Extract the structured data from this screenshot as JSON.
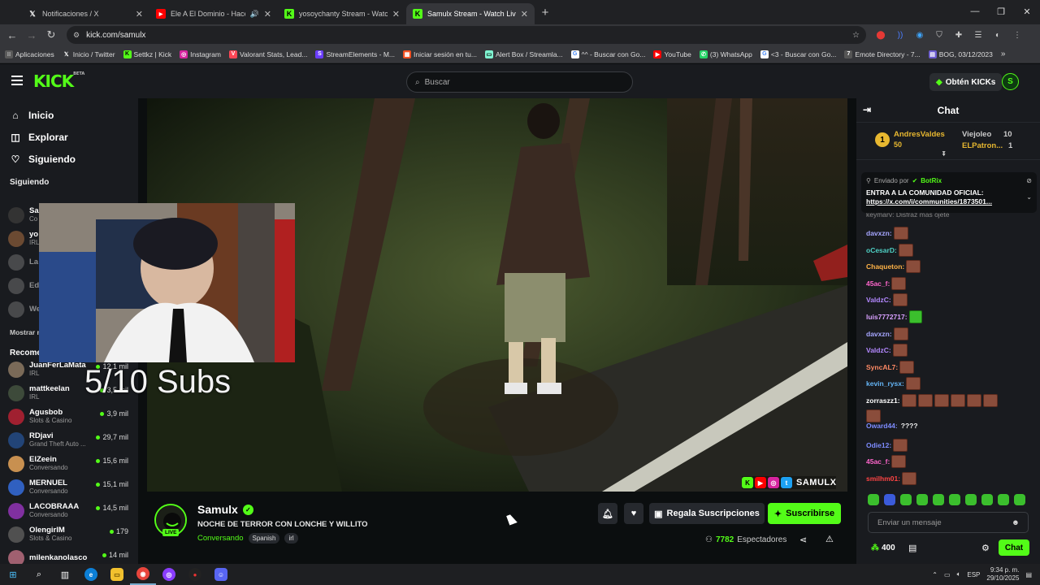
{
  "browser": {
    "tabs": [
      {
        "title": "Notificaciones / X",
        "icon": "x-icon"
      },
      {
        "title": "Ele A El Dominio - Hace Mu",
        "icon": "youtube-icon"
      },
      {
        "title": "yosoychanty Stream - Watch Li",
        "icon": "kick-icon"
      },
      {
        "title": "Samulx Stream - Watch Live on",
        "icon": "kick-icon"
      }
    ],
    "url": "kick.com/samulx",
    "bookmarks": [
      "Aplicaciones",
      "Inicio / Twitter",
      "Settkz | Kick",
      "Instagram",
      "Valorant Stats, Lead...",
      "StreamElements - M...",
      "Iniciar sesión en tu...",
      "Alert Box / Streamla...",
      "^^ - Buscar con Go...",
      "YouTube",
      "(3) WhatsApp",
      "<3 - Buscar con Go...",
      "Emote Directory - 7...",
      "BOG, 03/12/2023"
    ]
  },
  "kick": {
    "logo": "KICK",
    "logo_sup": "BETA",
    "search_placeholder": "Buscar",
    "kicks_button": "Obtén KICKs",
    "avatar_letter": "S"
  },
  "sidebar": {
    "nav": [
      {
        "label": "Inicio",
        "icon": "home-icon"
      },
      {
        "label": "Explorar",
        "icon": "compass-icon"
      },
      {
        "label": "Siguiendo",
        "icon": "heart-icon"
      }
    ],
    "following_header": "Siguiendo",
    "following": [
      {
        "name": "Sa",
        "category": "Co"
      },
      {
        "name": "yo",
        "category": "IRL"
      },
      {
        "name": "La",
        "category": ""
      },
      {
        "name": "Ed",
        "category": ""
      },
      {
        "name": "We",
        "category": ""
      }
    ],
    "show_more": "Mostrar m",
    "recommended_header": "Recome",
    "recommended": [
      {
        "name": "JuanFerLaMata",
        "category": "IRL",
        "viewers": "12,1 mil",
        "color": "#7a6a58"
      },
      {
        "name": "mattkeelan",
        "category": "IRL",
        "viewers": "3,5 mil",
        "color": "#3d4a3a"
      },
      {
        "name": "Agusbob",
        "category": "Slots & Casino",
        "viewers": "3,9 mil",
        "color": "#a02030"
      },
      {
        "name": "RDjavi",
        "category": "Grand Theft Auto ...",
        "viewers": "29,7 mil",
        "color": "#224477"
      },
      {
        "name": "ElZeein",
        "category": "Conversando",
        "viewers": "15,6 mil",
        "color": "#c89050"
      },
      {
        "name": "MERNUEL",
        "category": "Conversando",
        "viewers": "15,1 mil",
        "color": "#3060c0"
      },
      {
        "name": "LACOBRAAA",
        "category": "Conversando",
        "viewers": "14,5 mil",
        "color": "#8030a0"
      },
      {
        "name": "OlengirIM",
        "category": "Slots & Casino",
        "viewers": "179",
        "color": "#505050"
      },
      {
        "name": "milenkanolasco",
        "category": "",
        "viewers": "14 mil",
        "color": "#a06070"
      }
    ]
  },
  "player": {
    "overlay_text": "5/10 Subs",
    "watermark": "SAMULX"
  },
  "stream": {
    "streamer": "Samulx",
    "live_badge": "LIVE",
    "title": "NOCHE DE TERROR CON LONCHE Y WILLITO",
    "category": "Conversando",
    "tags": [
      "Spanish",
      "irl"
    ],
    "gift_button": "Regala Suscripciones",
    "subscribe_button": "Suscribirse",
    "viewers_count": "7782",
    "viewers_label": "Espectadores"
  },
  "chat": {
    "header": "Chat",
    "leaderboard": [
      {
        "rank": "1",
        "name": "AndresValdes",
        "value": "50"
      },
      {
        "name": "Viejoleo",
        "value": "10"
      },
      {
        "name": "ELPatron...",
        "value": "1"
      }
    ],
    "pinned_by_label": "Enviado por",
    "pinned_by_user": "BotRix",
    "pinned_title": "ENTRA A LA COMUNIDAD OFICIAL:",
    "pinned_link": "https://x.com/i/communities/1873501...",
    "partial_message": "keymarv: Disfraz mas ojete",
    "messages": [
      {
        "user": "davxzn:",
        "color": "#a6a6ff",
        "emotes": 1,
        "text": ""
      },
      {
        "user": "oCesarD:",
        "color": "#4fd1c5",
        "emotes": 1,
        "text": ""
      },
      {
        "user": "Chaqueton:",
        "color": "#ffb347",
        "emotes": 1,
        "text": ""
      },
      {
        "user": "45ac_f:",
        "color": "#ff66cc",
        "emotes": 1,
        "text": ""
      },
      {
        "user": "ValdzC:",
        "color": "#b388ff",
        "emotes": 1,
        "text": ""
      },
      {
        "user": "luis7772717:",
        "color": "#d8a0ff",
        "emotes": 0,
        "text": ""
      },
      {
        "user": "davxzn:",
        "color": "#a6a6ff",
        "emotes": 1,
        "text": ""
      },
      {
        "user": "ValdzC:",
        "color": "#b388ff",
        "emotes": 1,
        "text": ""
      },
      {
        "user": "SyncAL7:",
        "color": "#ff8a65",
        "emotes": 1,
        "text": ""
      },
      {
        "user": "kevin_rysx:",
        "color": "#64b5f6",
        "emotes": 1,
        "text": ""
      },
      {
        "user": "zorraszz1:",
        "color": "#ffffff",
        "emotes": 7,
        "text": ""
      },
      {
        "user": "Oward44:",
        "color": "#7e8cff",
        "emotes": 0,
        "text": "????"
      },
      {
        "user": "Odie12:",
        "color": "#7e8cff",
        "emotes": 1,
        "text": ""
      },
      {
        "user": "45ac_f:",
        "color": "#ff66cc",
        "emotes": 1,
        "text": ""
      },
      {
        "user": "smilhm01:",
        "color": "#ff4444",
        "emotes": 1,
        "text": ""
      }
    ],
    "input_placeholder": "Enviar un mensaje",
    "points": "400",
    "send_button": "Chat"
  },
  "taskbar": {
    "language": "ESP",
    "time": "9:34 p. m.",
    "date": "29/10/2025"
  },
  "colors": {
    "kick_green": "#53fc18",
    "bg": "#0b0e0f",
    "panel": "#191b1f"
  }
}
